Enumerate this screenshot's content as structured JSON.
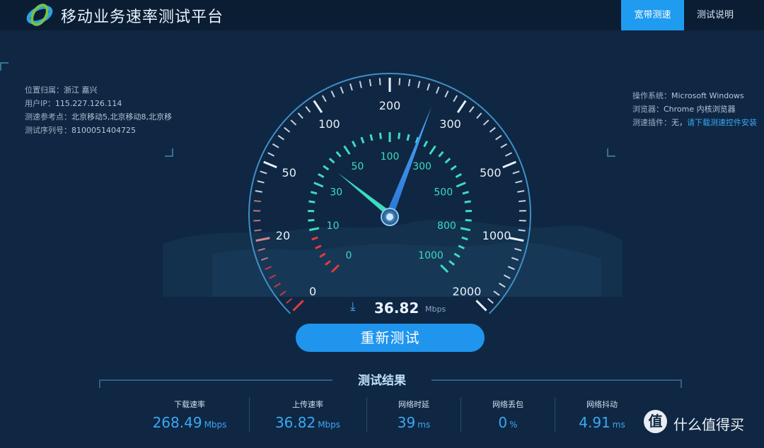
{
  "header": {
    "title": "移动业务速率测试平台",
    "tabs": [
      {
        "label": "宽带测速",
        "active": true
      },
      {
        "label": "测试说明",
        "active": false
      }
    ]
  },
  "left_info": {
    "location_label": "位置归属：",
    "location_value": "浙江 嘉兴",
    "ip_label": "用户IP：",
    "ip_value": "115.227.126.114",
    "ref_label": "测速参考点：",
    "ref_value": "北京移动5,北京移动8,北京移",
    "serial_label": "测试序列号：",
    "serial_value": "8100051404725"
  },
  "right_info": {
    "os_label": "操作系统：",
    "os_value": "Microsoft Windows",
    "browser_label": "浏览器：",
    "browser_value": "Chrome 内核浏览器",
    "plugin_label": "测速插件：",
    "plugin_value": "无，",
    "plugin_link": "请下载测速控件安装"
  },
  "gauge": {
    "outer_labels": [
      "0",
      "20",
      "50",
      "100",
      "200",
      "300",
      "500",
      "1000",
      "2000"
    ],
    "inner_labels": [
      "0",
      "10",
      "30",
      "50",
      "100",
      "300",
      "500",
      "800",
      "1000"
    ]
  },
  "current_speed": {
    "value": "36.82",
    "unit": "Mbps"
  },
  "retest_label": "重新测试",
  "results": {
    "title": "测试结果",
    "items": [
      {
        "label": "下载速率",
        "value": "268.49",
        "unit": "Mbps"
      },
      {
        "label": "上传速率",
        "value": "36.82",
        "unit": "Mbps"
      },
      {
        "label": "网络时延",
        "value": "39",
        "unit": "ms"
      },
      {
        "label": "网络丢包",
        "value": "0",
        "unit": "%"
      },
      {
        "label": "网络抖动",
        "value": "4.91",
        "unit": "ms"
      }
    ]
  },
  "watermark": {
    "icon_text": "值",
    "text": "什么值得买"
  },
  "colors": {
    "accent": "#1f9bf0",
    "background": "#0f2742",
    "teal": "#3ddbc0",
    "red": "#e23b3b"
  }
}
